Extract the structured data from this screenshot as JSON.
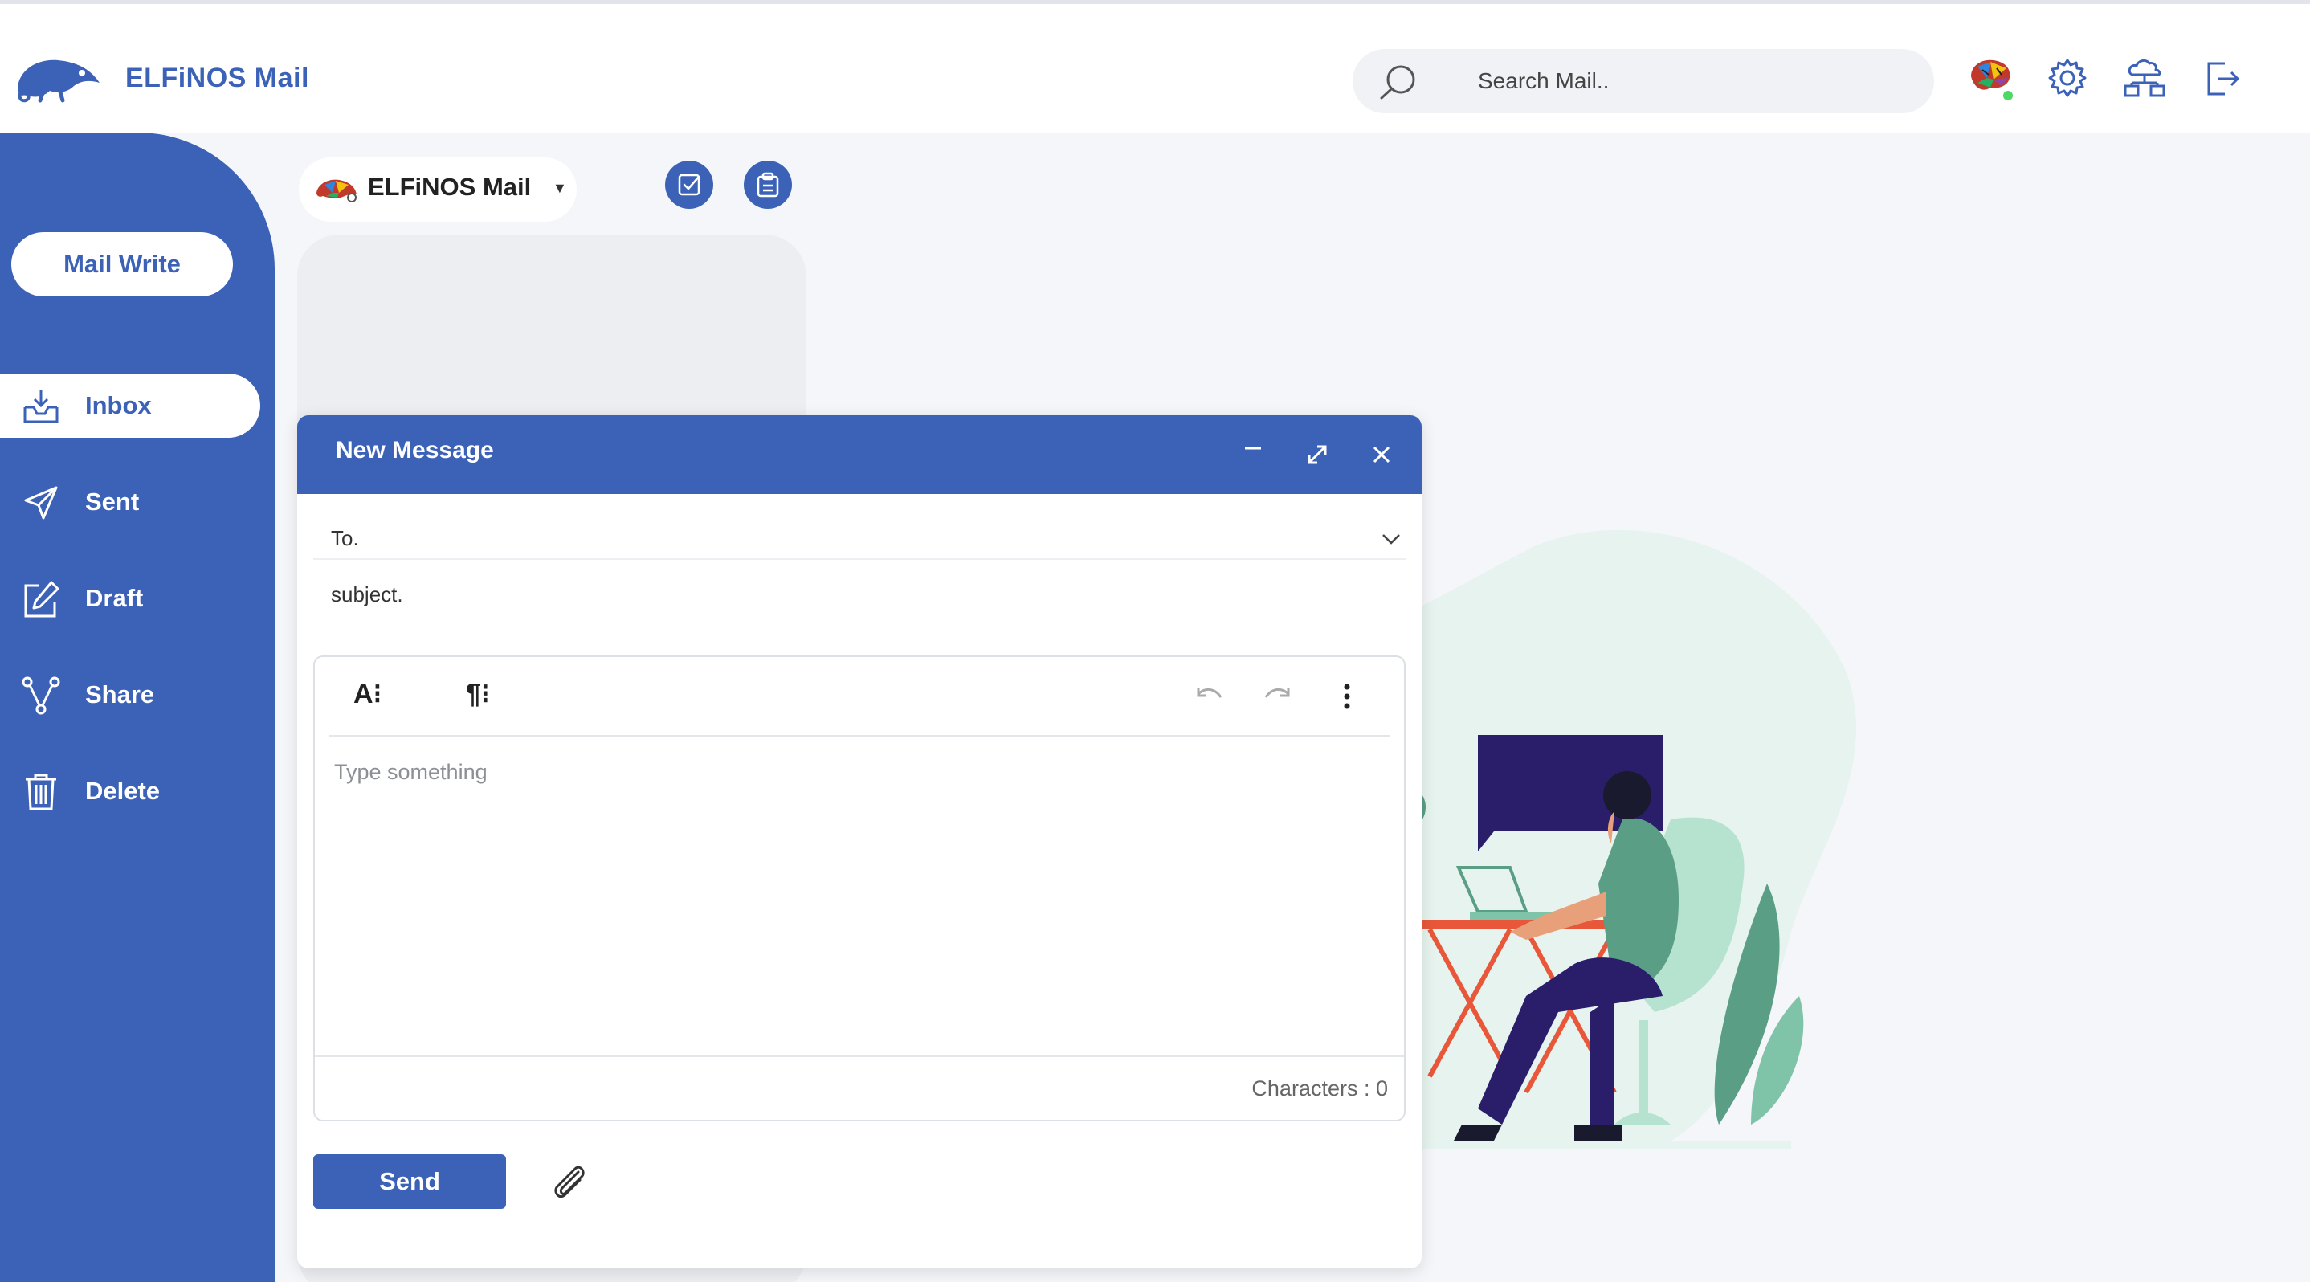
{
  "app": {
    "brand": "ELFiNOS Mail",
    "accent_color": "#3c62b8"
  },
  "header": {
    "search_placeholder": "Search Mail..",
    "icons": [
      "search-icon",
      "profile-avatar-icon",
      "settings-gear-icon",
      "cloud-network-icon",
      "logout-icon"
    ]
  },
  "sidebar": {
    "mail_write_label": "Mail Write",
    "items": [
      {
        "label": "Inbox",
        "icon": "inbox-icon",
        "active": true
      },
      {
        "label": "Sent",
        "icon": "send-icon"
      },
      {
        "label": "Draft",
        "icon": "edit-icon"
      },
      {
        "label": "Share",
        "icon": "share-icon"
      },
      {
        "label": "Delete",
        "icon": "trash-icon"
      }
    ]
  },
  "account": {
    "name": "ELFiNOS Mail"
  },
  "toolbar_buttons": [
    "check-square-icon",
    "clipboard-icon"
  ],
  "compose": {
    "title": "New Message",
    "to_placeholder": "To.",
    "subject_placeholder": "subject.",
    "body_placeholder": "Type something",
    "font_format_label": "A⁝",
    "paragraph_format_label": "¶⁝",
    "char_count_text": "Characters : 0",
    "send_label": "Send"
  }
}
